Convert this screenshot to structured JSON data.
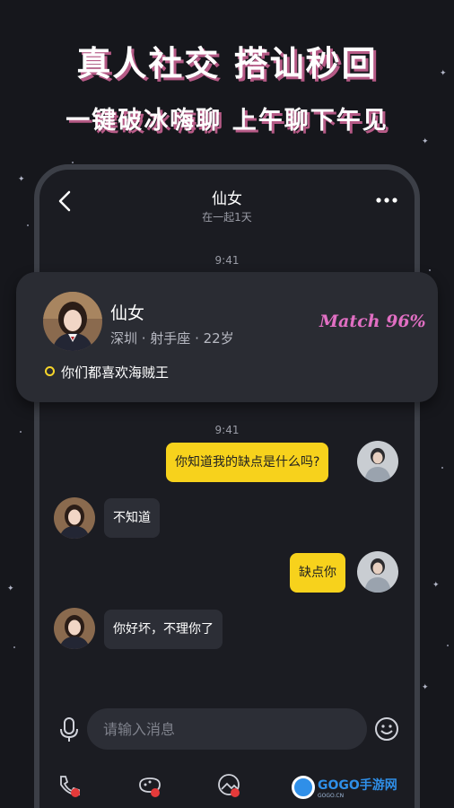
{
  "headline": {
    "line1": "真人社交  搭讪秒回",
    "line2": "一键破冰嗨聊  上午聊下午见"
  },
  "chat_header": {
    "title": "仙女",
    "subtitle": "在一起1天"
  },
  "timestamps": [
    "9:41",
    "9:41"
  ],
  "profile_card": {
    "name": "仙女",
    "info": "深圳 · 射手座 · 22岁",
    "match": "Match 96%",
    "tag": "你们都喜欢海贼王"
  },
  "messages": [
    {
      "from": "me",
      "text": "你知道我的缺点是什么吗?"
    },
    {
      "from": "her",
      "text": "不知道"
    },
    {
      "from": "me",
      "text": "缺点你"
    },
    {
      "from": "her",
      "text": "你好坏，不理你了"
    }
  ],
  "input": {
    "placeholder": "请输入消息"
  },
  "watermark": {
    "brand": "GOGO手游网",
    "domain": "GOGO.CN"
  },
  "icons": [
    "back-icon",
    "more-icon",
    "mic-icon",
    "smile-icon",
    "call-icon",
    "game-icon",
    "photo-icon",
    "gift-icon"
  ],
  "colors": {
    "accent_yellow": "#f7d21c",
    "match_pink": "#e16fc3",
    "headline_shadow": "#b65a86",
    "background": "#16171c"
  }
}
